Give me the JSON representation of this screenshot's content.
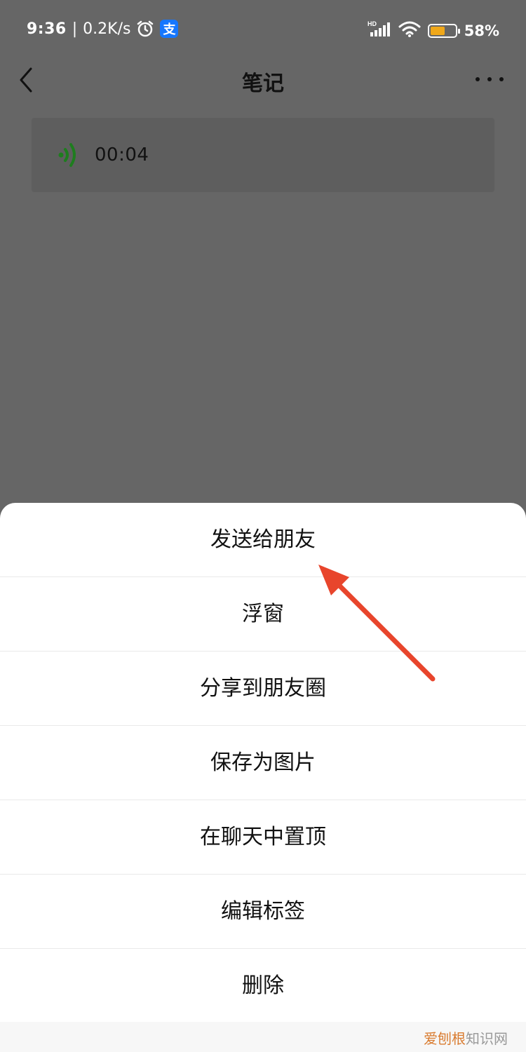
{
  "status_bar": {
    "time": "9:36",
    "separator": "|",
    "speed": "0.2K/s",
    "pay_glyph": "支",
    "battery_percent": "58%",
    "battery_level": 0.58,
    "signal_label": "HD",
    "icons": [
      "alarm-icon",
      "alipay-icon",
      "signal-icon",
      "wifi-icon",
      "battery-icon"
    ]
  },
  "header": {
    "title": "笔记",
    "back_icon": "chevron-left-icon",
    "more_icon": "more-dots-icon"
  },
  "voice_note": {
    "duration": "00:04",
    "icon": "voice-wave-icon",
    "icon_color": "#1e7d1e"
  },
  "action_sheet": {
    "items": [
      {
        "label": "发送给朋友"
      },
      {
        "label": "浮窗"
      },
      {
        "label": "分享到朋友圈"
      },
      {
        "label": "保存为图片"
      },
      {
        "label": "在聊天中置顶"
      },
      {
        "label": "编辑标签"
      },
      {
        "label": "删除"
      }
    ]
  },
  "annotation": {
    "arrow_color": "#e8452c"
  },
  "watermark": {
    "accent": "爱刨根",
    "rest": "知识网"
  },
  "colors": {
    "overlay_bg": "#666666",
    "sheet_bg": "#ffffff",
    "battery_fill": "#f0a81a"
  }
}
